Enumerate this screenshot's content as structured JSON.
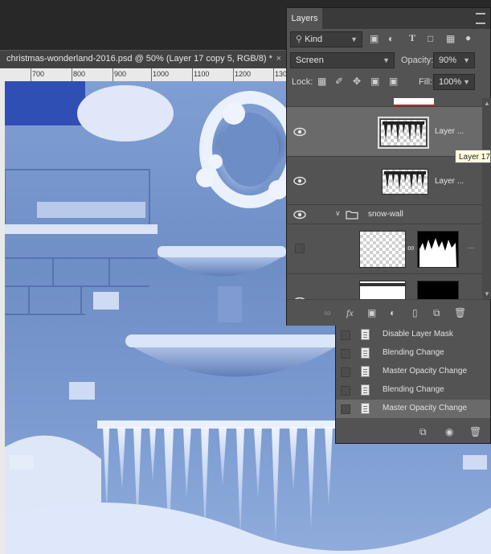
{
  "document": {
    "tab_title": "christmas-wonderland-2016.psd @ 50% (Layer 17 copy 5, RGB/8) *",
    "close_label": "×",
    "ruler_labels": [
      "700",
      "800",
      "900",
      "1000",
      "1100",
      "1200",
      "130"
    ]
  },
  "layers_panel": {
    "tab_label": "Layers",
    "filter_kind": "Kind",
    "blend_mode": "Screen",
    "opacity_label": "Opacity:",
    "opacity_value": "90%",
    "lock_label": "Lock:",
    "fill_label": "Fill:",
    "fill_value": "100%",
    "layers": [
      {
        "name": "Layer ...",
        "visible": true,
        "selected": true
      },
      {
        "name": "Layer ...",
        "visible": true,
        "selected": false
      },
      {
        "name": "snow-wall",
        "visible": true,
        "type": "group"
      },
      {
        "name": "",
        "visible": false,
        "masked": true
      },
      {
        "name": "",
        "visible": true,
        "masked": true
      }
    ]
  },
  "tooltip": {
    "text": "Layer 17"
  },
  "history_panel": {
    "items": [
      {
        "label": "Disable Layer Mask"
      },
      {
        "label": "Blending Change"
      },
      {
        "label": "Master Opacity Change"
      },
      {
        "label": "Blending Change"
      },
      {
        "label": "Master Opacity Change",
        "selected": true
      }
    ]
  },
  "colors": {
    "panel_bg": "#535353",
    "selected_layer": "#6a6a6a",
    "canvas_blue": "#7f9fd4",
    "tooltip_bg": "#ffffe1"
  }
}
